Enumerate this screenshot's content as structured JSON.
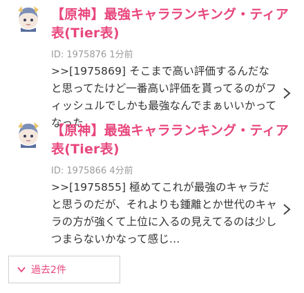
{
  "posts": [
    {
      "title": "【原神】最強キャラランキング・ティア表(Tier表)",
      "meta": "ID: 1975876 1分前",
      "excerpt": ">>[1975869] そこまで高い評価するんだなと思ってたけど一番高い評価を貰ってるのがフィッシュルでしかも最強なんでまぁいいかってなった",
      "avatar_icon": "character-avatar-icon",
      "chevron_icon": "chevron-right-icon"
    },
    {
      "title": "【原神】最強キャラランキング・ティア表(Tier表)",
      "meta": "ID: 1975866 4分前",
      "excerpt": ">>[1975855] 極めてこれが最強のキャラだと思うのだが、それよりも鍾離とか世代のキャラの方が強くて上位に入るの見えてるのは少しつまらないかなって感じ…",
      "avatar_icon": "character-avatar-icon",
      "chevron_icon": "chevron-right-icon"
    }
  ],
  "more_button": {
    "label": "過去2件",
    "icon": "caret-down-icon"
  },
  "colors": {
    "accent": "#e8467c",
    "meta": "#9a9a9a",
    "text": "#333333"
  }
}
